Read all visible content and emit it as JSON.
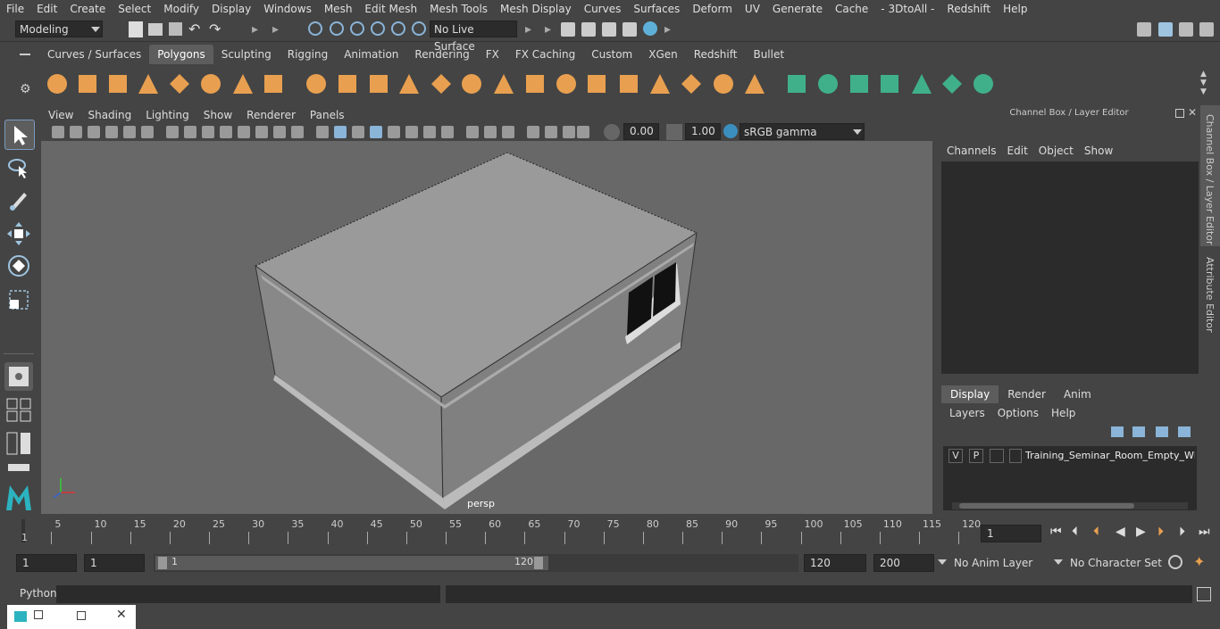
{
  "menubar": {
    "items": [
      "File",
      "Edit",
      "Create",
      "Select",
      "Modify",
      "Display",
      "Windows",
      "Mesh",
      "Edit Mesh",
      "Mesh Tools",
      "Mesh Display",
      "Curves",
      "Surfaces",
      "Deform",
      "UV",
      "Generate",
      "Cache",
      "- 3DtoAll -",
      "Redshift",
      "Help"
    ]
  },
  "statusline": {
    "mode": "Modeling",
    "live_surface": "No Live Surface"
  },
  "shelf": {
    "tabs": [
      "Curves / Surfaces",
      "Polygons",
      "Sculpting",
      "Rigging",
      "Animation",
      "Rendering",
      "FX",
      "FX Caching",
      "Custom",
      "XGen",
      "Redshift",
      "Bullet"
    ],
    "active_tab": "Polygons"
  },
  "viewport": {
    "menu": [
      "View",
      "Shading",
      "Lighting",
      "Show",
      "Renderer",
      "Panels"
    ],
    "exposure": "0.00",
    "gamma": "1.00",
    "color_space": "sRGB gamma",
    "camera_label": "persp"
  },
  "channel_box": {
    "title": "Channel Box / Layer Editor",
    "menu": [
      "Channels",
      "Edit",
      "Object",
      "Show"
    ]
  },
  "layer_editor": {
    "tabs": [
      "Display",
      "Render",
      "Anim"
    ],
    "active_tab": "Display",
    "menu": [
      "Layers",
      "Options",
      "Help"
    ],
    "layer": {
      "v": "V",
      "p": "P",
      "name": "Training_Seminar_Room_Empty_Whit"
    }
  },
  "side_tabs": {
    "channel_box": "Channel Box / Layer Editor",
    "attribute_editor": "Attribute Editor"
  },
  "timeline": {
    "ticks": [
      "5",
      "10",
      "15",
      "20",
      "25",
      "30",
      "35",
      "40",
      "45",
      "50",
      "55",
      "60",
      "65",
      "70",
      "75",
      "80",
      "85",
      "90",
      "95",
      "100",
      "105",
      "110",
      "115",
      "120"
    ],
    "start_mark": "1",
    "current_frame": "1"
  },
  "range": {
    "start": "1",
    "playback_start": "1",
    "slider_start": "1",
    "slider_end": "120",
    "playback_end": "120",
    "end": "200",
    "anim_layer": "No Anim Layer",
    "character_set": "No Character Set"
  },
  "command_line": {
    "label": "Python"
  },
  "colors": {
    "accent": "#5285a6",
    "shelf_orange": "#e8a050",
    "shelf_green": "#40b08a"
  }
}
